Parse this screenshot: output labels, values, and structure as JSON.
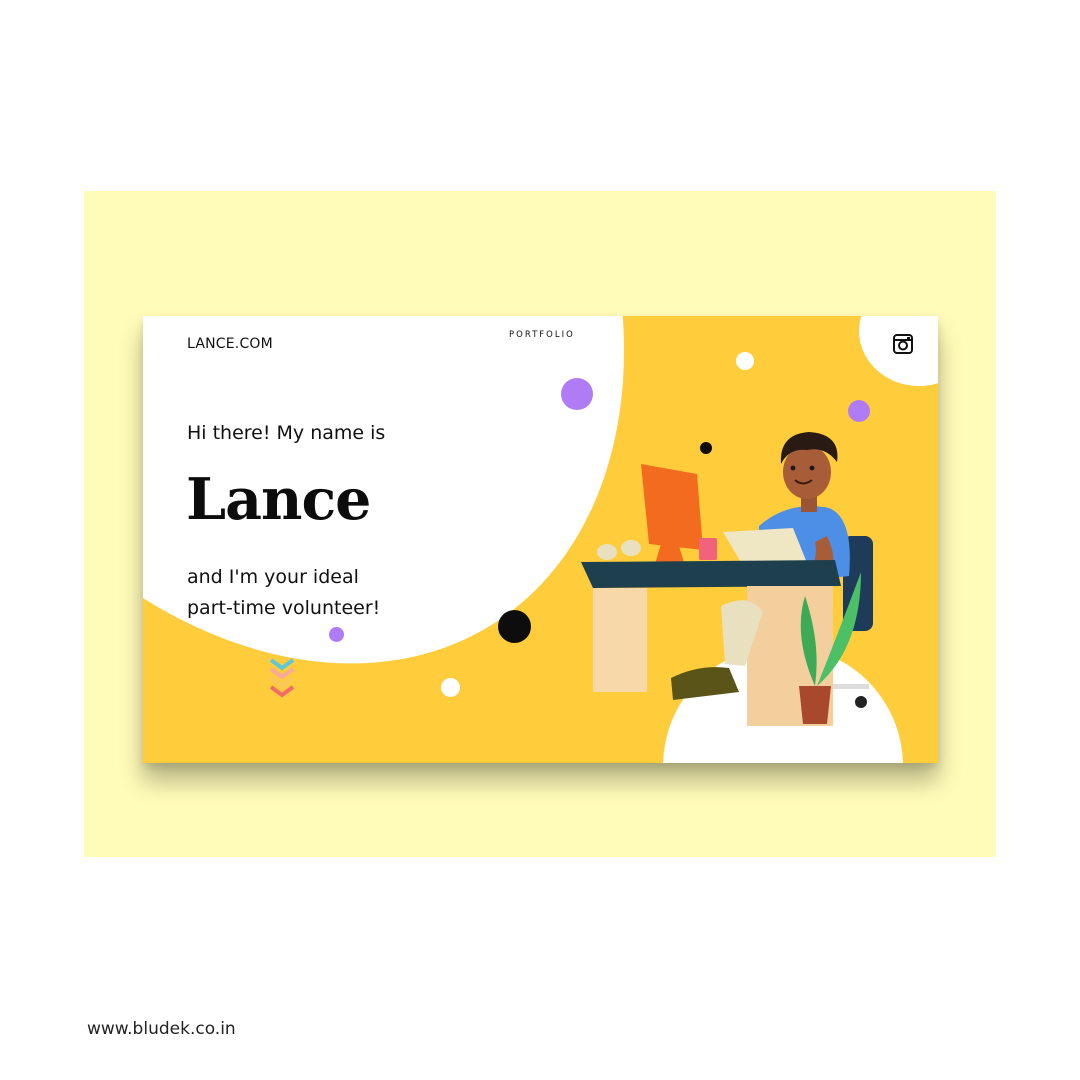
{
  "header": {
    "brand": "LANCE.COM",
    "nav_portfolio": "PORTFOLIO",
    "social_icon": "instagram-icon"
  },
  "hero": {
    "greeting": "Hi there! My name is",
    "name": "Lance",
    "tagline_line1": "and I'm your ideal",
    "tagline_line2": "part-time volunteer!"
  },
  "decor": {
    "scroll_icon": "chevron-down-stack-icon",
    "illustration": "person-at-desk-illustration"
  },
  "colors": {
    "accent_yellow": "#ffcc3c",
    "backdrop_yellow": "#fffbb8",
    "purple_dot": "#b07cf5",
    "chevron_teal": "#5ec8d8",
    "chevron_yellow": "#f7c85a",
    "chevron_coral": "#f46a6a"
  },
  "footer": {
    "url": "www.bludek.co.in"
  }
}
